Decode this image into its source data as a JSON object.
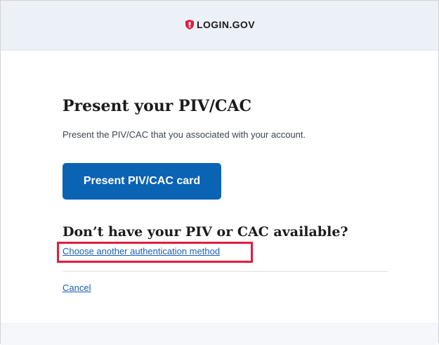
{
  "header": {
    "logo_text": "LOGIN.GOV",
    "logo_icon": "shield-icon",
    "logo_color": "#e21c3d",
    "background": "#ecf1f7"
  },
  "main": {
    "title": "Present your PIV/CAC",
    "lead": "Present the PIV/CAC that you associated with your account.",
    "primary_button_label": "Present PIV/CAC card",
    "primary_button_color": "#0b63b4",
    "alternative_heading": "Don’t have your PIV or CAC available?",
    "alternative_link": "Choose another authentication method",
    "highlight_color": "#e21c3d",
    "cancel_link": "Cancel",
    "link_color": "#1a5eb0"
  }
}
